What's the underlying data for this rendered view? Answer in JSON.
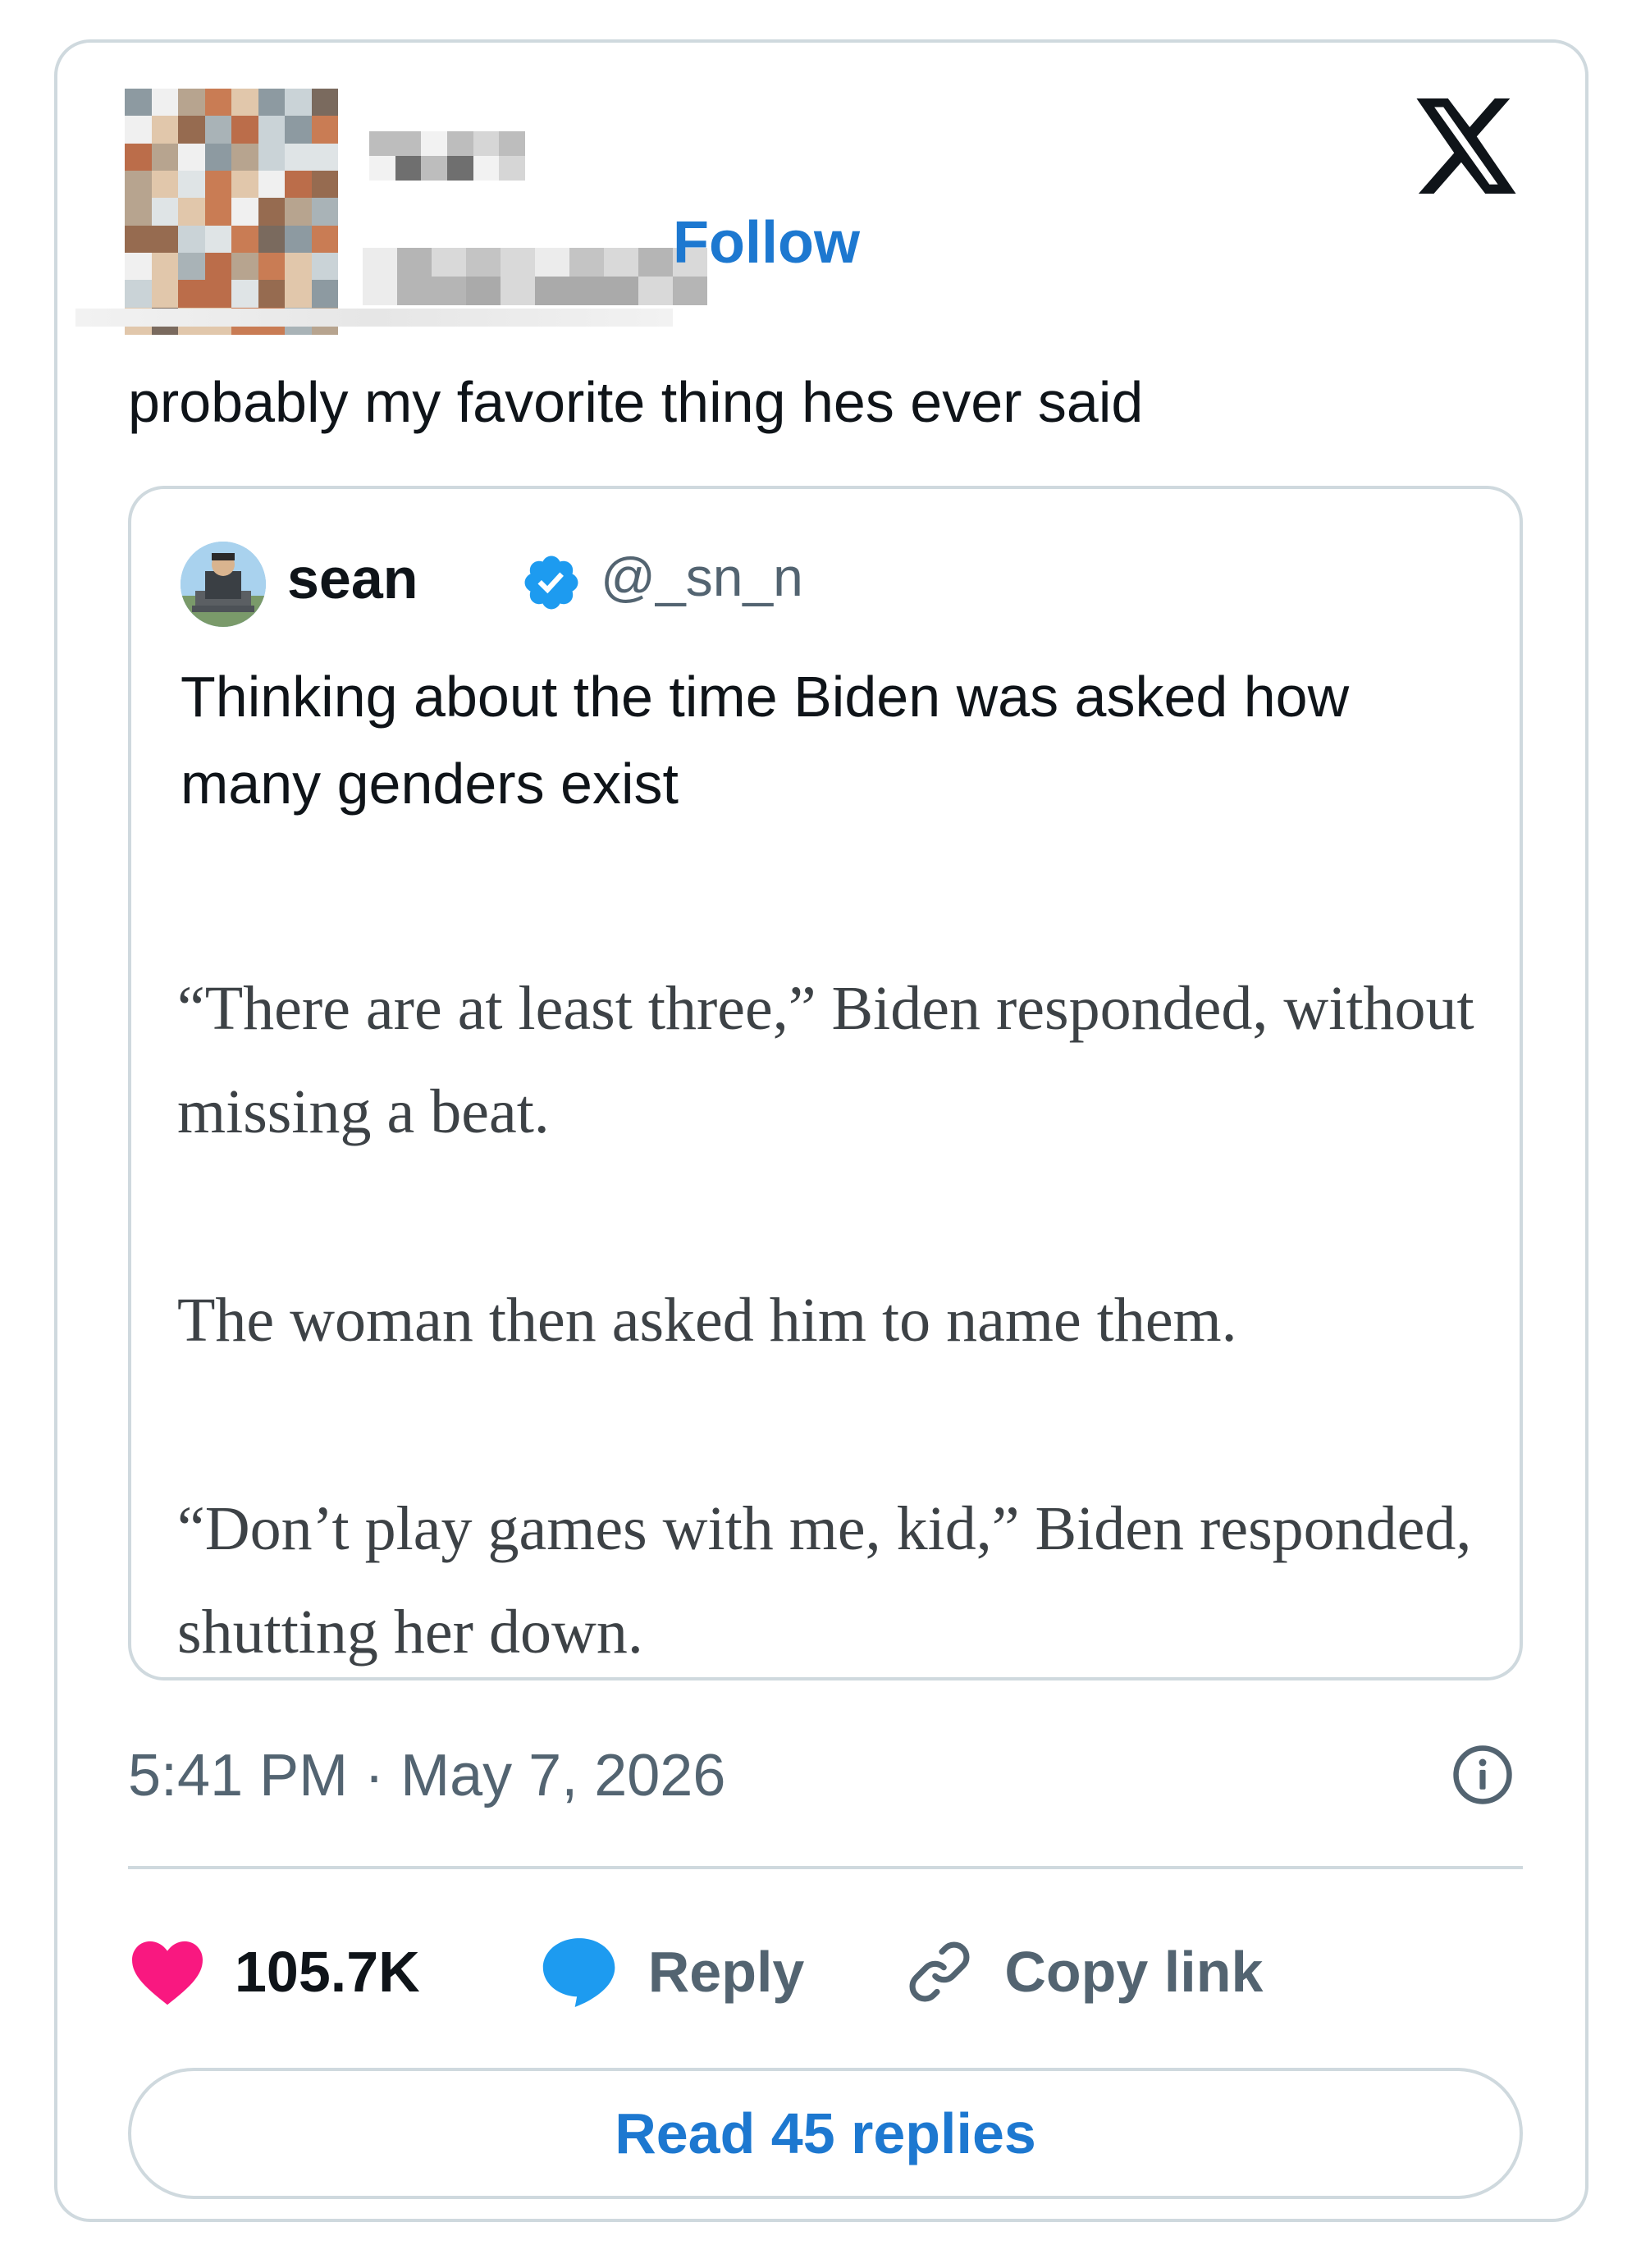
{
  "header": {
    "follow_label": "Follow",
    "logo_icon": "x-logo-icon"
  },
  "tweet": {
    "text": "probably my favorite thing hes ever said",
    "timestamp": "5:41 PM · May 7, 2026"
  },
  "quoted_tweet": {
    "author_name": "sean",
    "author_handle": "@_sn_n",
    "verified": true,
    "text": "Thinking about the time Biden was asked how many genders exist",
    "article_paragraphs": [
      "“There are at least three,” Biden responded, without missing a beat.",
      "The woman then asked him to name them.",
      "“Don’t play games with me, kid,” Biden responded, shutting her down."
    ]
  },
  "actions": {
    "like_count": "105.7K",
    "reply_label": "Reply",
    "copy_link_label": "Copy link",
    "read_replies_label": "Read 45 replies"
  },
  "colors": {
    "link_blue": "#1d78d0",
    "heart_pink": "#f91880",
    "reply_blue": "#1d9bf0",
    "verified_blue": "#1d9bf0",
    "border": "#cfd9de",
    "muted_text": "#536471"
  }
}
